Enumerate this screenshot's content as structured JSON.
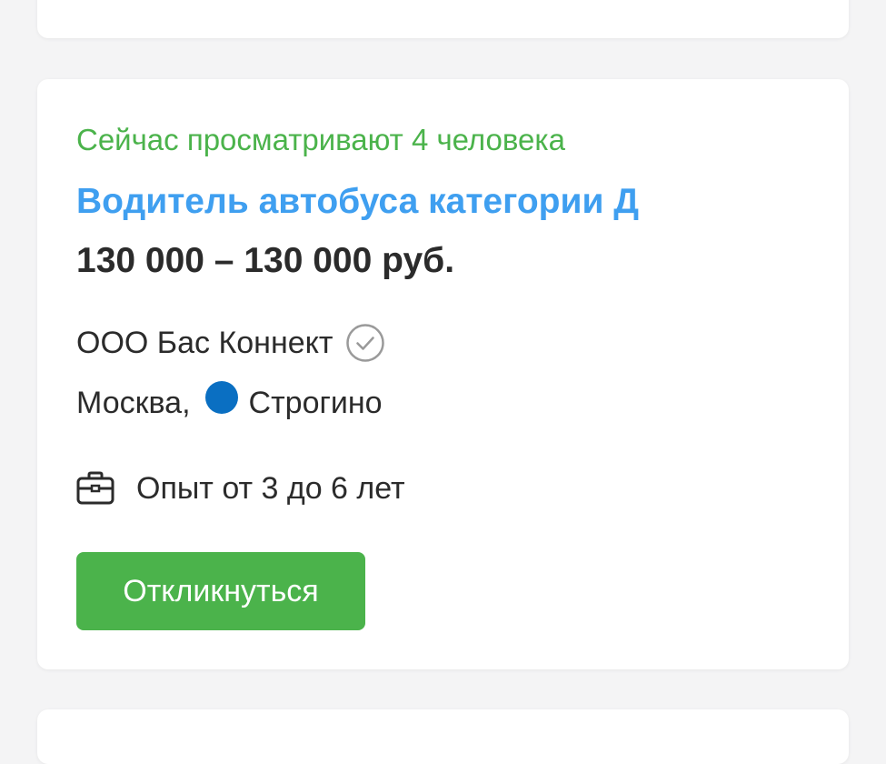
{
  "vacancy": {
    "viewers_text": "Сейчас просматривают 4 человека",
    "title": "Водитель автобуса категории Д",
    "salary": "130 000 – 130 000 руб.",
    "company": "ООО Бас Коннект",
    "company_verified_icon": "verified-check-icon",
    "city": "Москва,",
    "metro_station": "Строгино",
    "metro_line_color": "#0a6fc2",
    "experience_icon": "briefcase-icon",
    "experience": "Опыт от 3 до 6 лет",
    "respond_label": "Откликнуться"
  },
  "colors": {
    "accent_green": "#4bb34b",
    "title_blue": "#3f9ff0",
    "text_dark": "#2b2b2b"
  }
}
